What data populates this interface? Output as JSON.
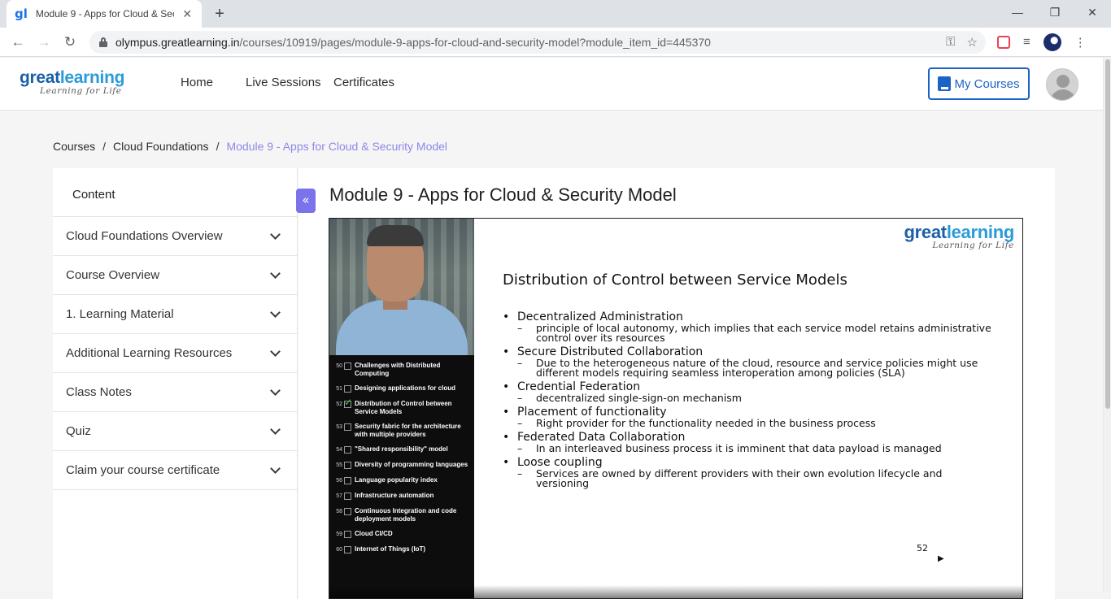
{
  "browser": {
    "tab_title": "Module 9 - Apps for Cloud & Sec",
    "favicon": "gl",
    "new_tab": "+",
    "close_tab": "✕",
    "url_host": "olympus.greatlearning.in",
    "url_path": "/courses/10919/pages/module-9-apps-for-cloud-and-security-model?module_item_id=445370",
    "controls": {
      "minimize": "—",
      "restore": "❐",
      "close": "✕"
    }
  },
  "header": {
    "logo_great": "great",
    "logo_learning": "learning",
    "logo_tagline": "Learning for Life",
    "nav": [
      "Home",
      "Live Sessions",
      "Certificates"
    ],
    "my_courses_label": "My Courses"
  },
  "breadcrumb": {
    "items": [
      "Courses",
      "Cloud Foundations"
    ],
    "separator": "/",
    "current": "Module 9 - Apps for Cloud & Security Model"
  },
  "sidebar": {
    "title": "Content",
    "collapse_label": "«",
    "items": [
      "Cloud Foundations Overview",
      "Course Overview",
      "1. Learning Material",
      "Additional Learning Resources",
      "Class Notes",
      "Quiz",
      "Claim your course certificate"
    ]
  },
  "main": {
    "title": "Module 9 - Apps for Cloud & Security Model"
  },
  "video": {
    "toc": [
      {
        "num": "50",
        "text": "Challenges with Distributed Computing",
        "checked": false
      },
      {
        "num": "51",
        "text": "Designing applications for cloud",
        "checked": false
      },
      {
        "num": "52",
        "text": "Distribution of Control between Service Models",
        "checked": true
      },
      {
        "num": "53",
        "text": "Security fabric for the architecture with multiple providers",
        "checked": false
      },
      {
        "num": "54",
        "text": "\"Shared responsibility\" model",
        "checked": false
      },
      {
        "num": "55",
        "text": "Diversity of programming languages",
        "checked": false
      },
      {
        "num": "56",
        "text": "Language popularity index",
        "checked": false
      },
      {
        "num": "57",
        "text": "Infrastructure automation",
        "checked": false
      },
      {
        "num": "58",
        "text": "Continuous Integration and code deployment models",
        "checked": false
      },
      {
        "num": "59",
        "text": "Cloud CI/CD",
        "checked": false
      },
      {
        "num": "60",
        "text": "Internet of Things (IoT)",
        "checked": false
      }
    ],
    "slide": {
      "logo_great": "great",
      "logo_learning": "learning",
      "logo_tagline": "Learning for Life",
      "heading": "Distribution of Control between Service Models",
      "bullets": [
        {
          "title": "Decentralized Administration",
          "sub": "principle of local autonomy, which implies that each service model retains administrative control over its resources"
        },
        {
          "title": "Secure Distributed Collaboration",
          "sub": "Due to the heterogeneous nature of the cloud, resource and service policies might use different models requiring seamless interoperation among policies (SLA)"
        },
        {
          "title": "Credential Federation",
          "sub": "decentralized single-sign-on mechanism"
        },
        {
          "title": "Placement of functionality",
          "sub": "Right provider for the functionality needed in the business process"
        },
        {
          "title": "Federated Data Collaboration",
          "sub": "In an interleaved business process it is imminent that data payload is managed"
        },
        {
          "title": "Loose coupling",
          "sub": "Services are owned by different providers with their own evolution lifecycle and versioning"
        }
      ],
      "page_number": "52",
      "next_arrow": "▶"
    }
  },
  "colors": {
    "brand_dark": "#1c5fa8",
    "brand_light": "#2b9bd8",
    "accent_purple": "#7b73ea",
    "breadcrumb_current": "#8f87e8",
    "button_blue": "#1b63c6"
  }
}
